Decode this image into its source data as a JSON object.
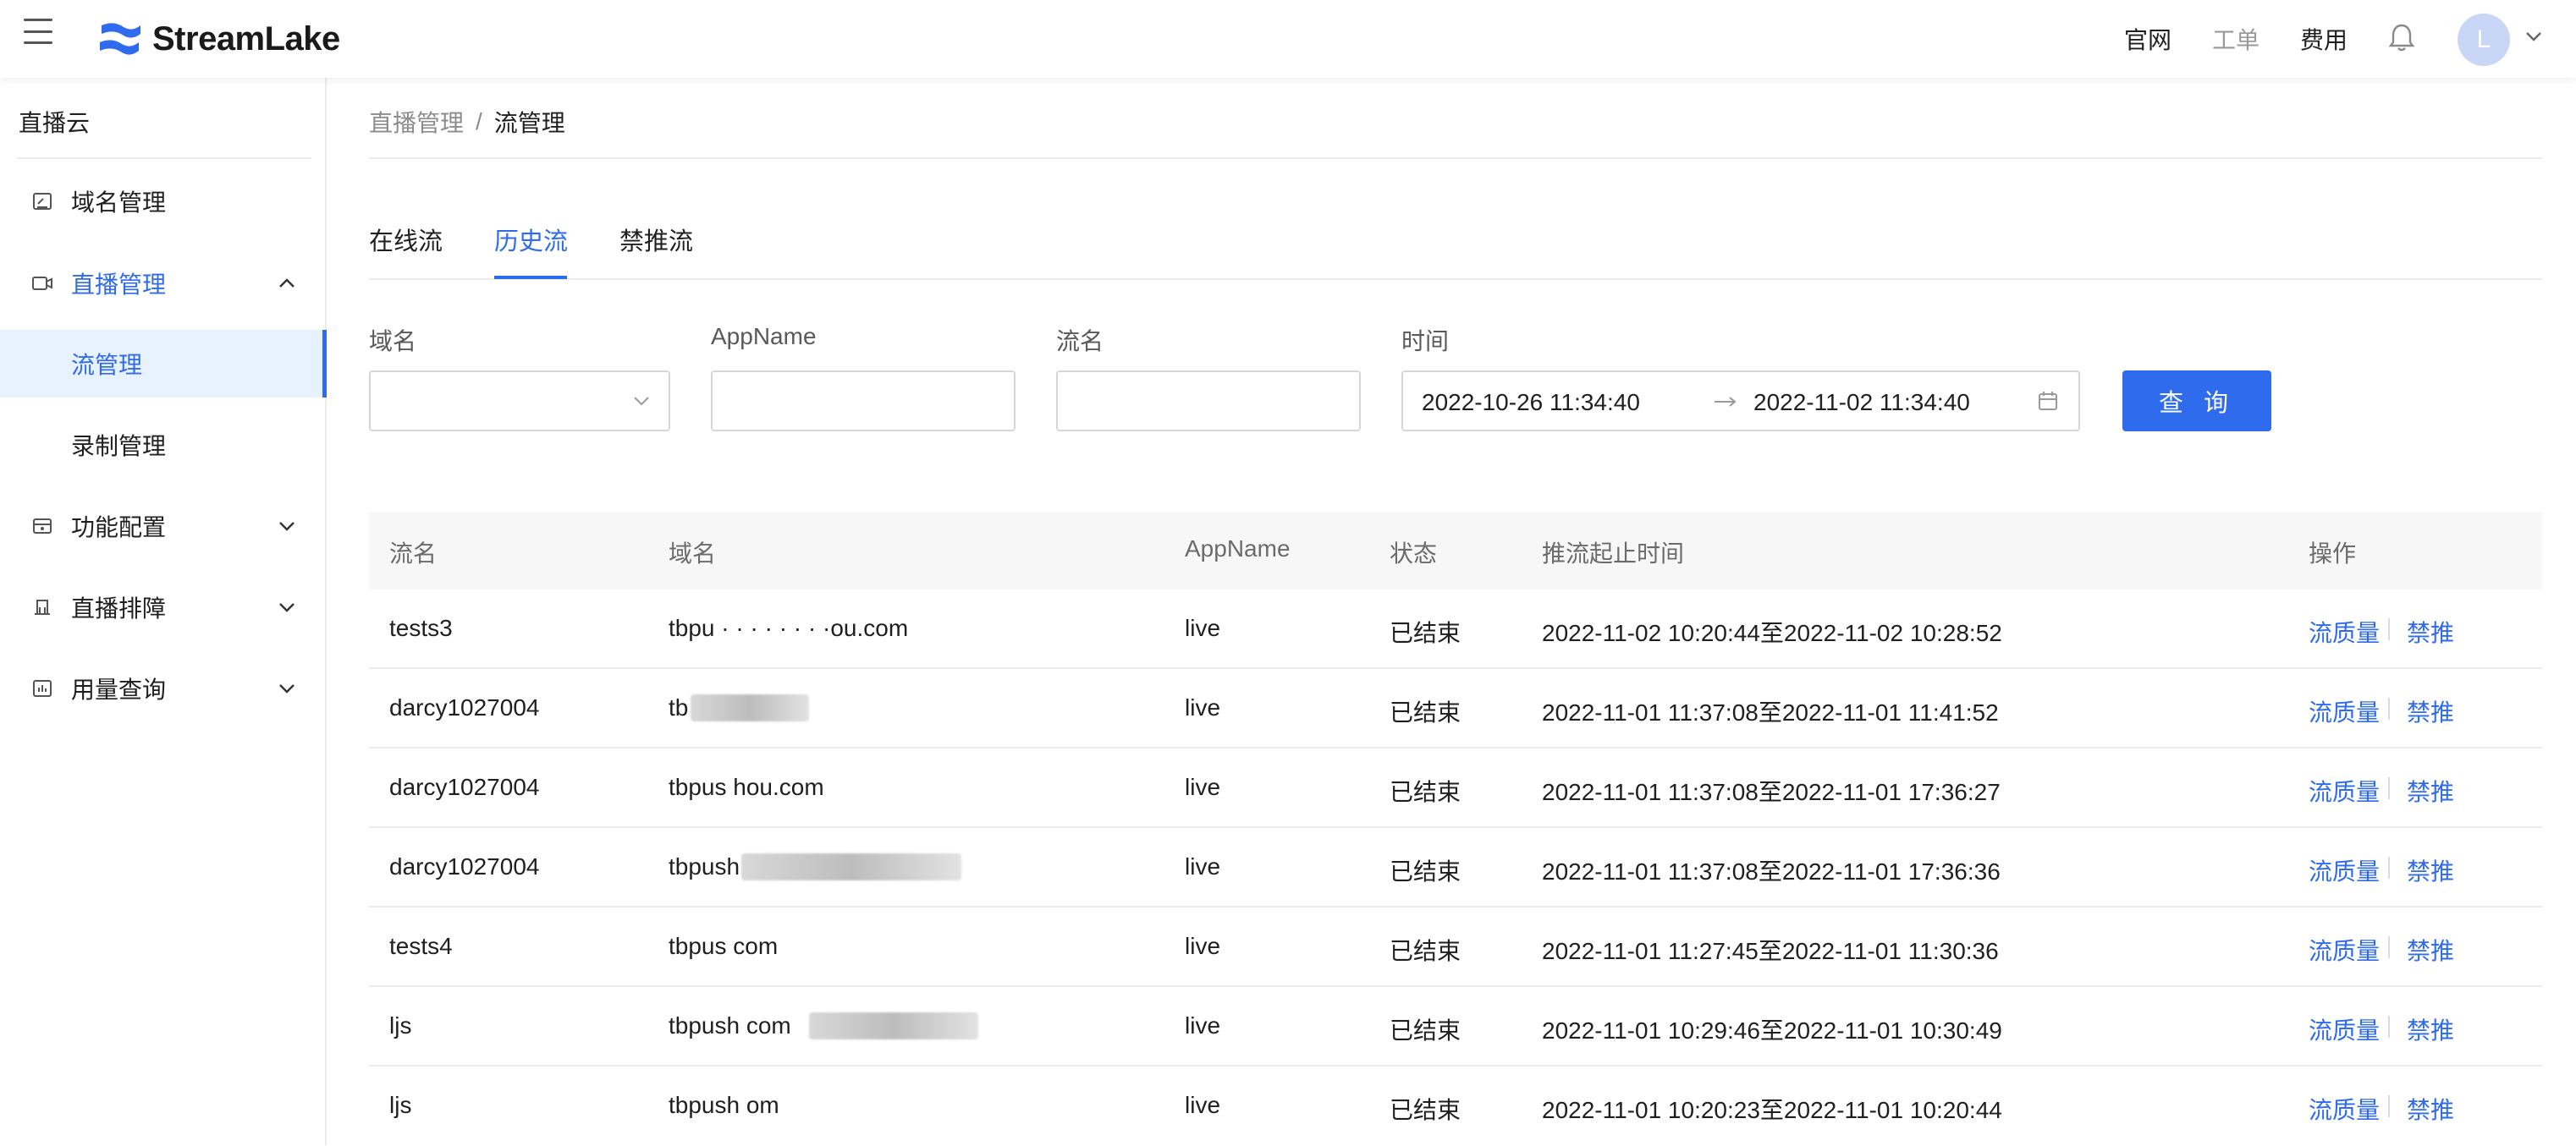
{
  "header": {
    "brand": "StreamLake",
    "links": [
      "官网",
      "工单",
      "费用"
    ],
    "avatar_initial": "L"
  },
  "sidebar": {
    "title": "直播云",
    "items": [
      {
        "label": "域名管理",
        "icon": "domain-icon"
      },
      {
        "label": "直播管理",
        "icon": "video-icon",
        "expanded": true,
        "children": [
          {
            "label": "流管理",
            "selected": true
          },
          {
            "label": "录制管理"
          }
        ]
      },
      {
        "label": "功能配置",
        "icon": "config-icon"
      },
      {
        "label": "直播排障",
        "icon": "troubleshoot-icon"
      },
      {
        "label": "用量查询",
        "icon": "usage-icon"
      }
    ]
  },
  "breadcrumb": {
    "parent": "直播管理",
    "sep": "/",
    "current": "流管理"
  },
  "tabs": [
    {
      "label": "在线流"
    },
    {
      "label": "历史流",
      "active": true
    },
    {
      "label": "禁推流"
    }
  ],
  "filters": {
    "domain_label": "域名",
    "app_label": "AppName",
    "stream_label": "流名",
    "time_label": "时间",
    "time_start": "2022-10-26 11:34:40",
    "time_end": "2022-11-02 11:34:40",
    "query_label": "查 询"
  },
  "table": {
    "columns": [
      "流名",
      "域名",
      "AppName",
      "状态",
      "推流起止时间",
      "操作"
    ],
    "rows": [
      {
        "stream": "tests3",
        "domain": "tbpu    ·   ·  ·  ·   ·  ·  ·  ·ou.com",
        "app": "live",
        "status": "已结束",
        "time": "2022-11-02 10:20:44至2022-11-02 10:28:52"
      },
      {
        "stream": "darcy1027004",
        "domain": "tb                              ·ku.                  com",
        "app": "live",
        "status": "已结束",
        "time": "2022-11-01 11:37:08至2022-11-01 11:41:52"
      },
      {
        "stream": "darcy1027004",
        "domain": "tbpus                                   hou.com",
        "app": "live",
        "status": "已结束",
        "time": "2022-11-01 11:37:08至2022-11-01 17:36:27"
      },
      {
        "stream": "darcy1027004",
        "domain": "tbpush                                       com",
        "app": "live",
        "status": "已结束",
        "time": "2022-11-01 11:37:08至2022-11-01 17:36:36"
      },
      {
        "stream": "tests4",
        "domain": "tbpus                                           com",
        "app": "live",
        "status": "已结束",
        "time": "2022-11-01 11:27:45至2022-11-01 11:30:36"
      },
      {
        "stream": "ljs",
        "domain": "tbpush                                         com",
        "app": "live",
        "status": "已结束",
        "time": "2022-11-01 10:29:46至2022-11-01 10:30:49"
      },
      {
        "stream": "ljs",
        "domain": "tbpush                                         om",
        "app": "live",
        "status": "已结束",
        "time": "2022-11-01 10:20:23至2022-11-01 10:20:44"
      }
    ],
    "actions": [
      "流质量",
      "禁推"
    ]
  },
  "colors": {
    "accent": "#2f6bed",
    "brand": "#2f6bed"
  }
}
